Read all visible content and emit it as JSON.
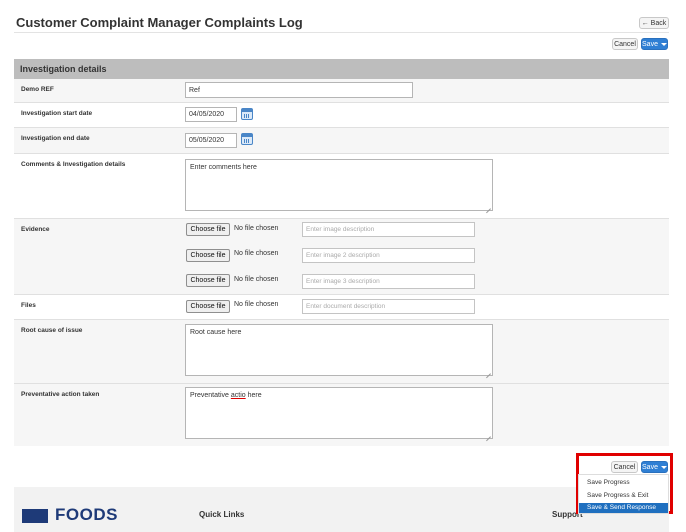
{
  "header": {
    "title": "Customer Complaint Manager Complaints Log",
    "back_label": "← Back",
    "cancel_label": "Cancel",
    "save_label": "Save"
  },
  "section": {
    "title": "Investigation details"
  },
  "fields": {
    "demo_ref": {
      "label": "Demo REF",
      "value": "Ref"
    },
    "start_date": {
      "label": "Investigation start date",
      "value": "04/05/2020"
    },
    "end_date": {
      "label": "Investigation end date",
      "value": "05/05/2020"
    },
    "comments": {
      "label": "Comments & Investigation details",
      "value": "Enter comments here"
    },
    "evidence": {
      "label": "Evidence",
      "choose_label": "Choose file",
      "no_file": "No file chosen",
      "placeholders": [
        "Enter image description",
        "Enter image 2 description",
        "Enter image 3 description"
      ]
    },
    "files": {
      "label": "Files",
      "choose_label": "Choose file",
      "no_file": "No file chosen",
      "placeholder": "Enter document description"
    },
    "root_cause": {
      "label": "Root cause of issue",
      "value": "Root cause here"
    },
    "preventative": {
      "label": "Preventative action taken",
      "value_prefix": "Preventative ",
      "value_misspelled": "actio",
      "value_suffix": " here"
    }
  },
  "bottom_actions": {
    "cancel_label": "Cancel",
    "save_label": "Save",
    "menu": [
      "Save Progress",
      "Save Progress & Exit",
      "Save & Send Response"
    ]
  },
  "footer": {
    "logo_text": "FOODS",
    "quick_links": "Quick Links",
    "support": "Support"
  },
  "colors": {
    "accent": "#2f7fd4",
    "highlight": "#e00000",
    "logo": "#1e3a78"
  }
}
